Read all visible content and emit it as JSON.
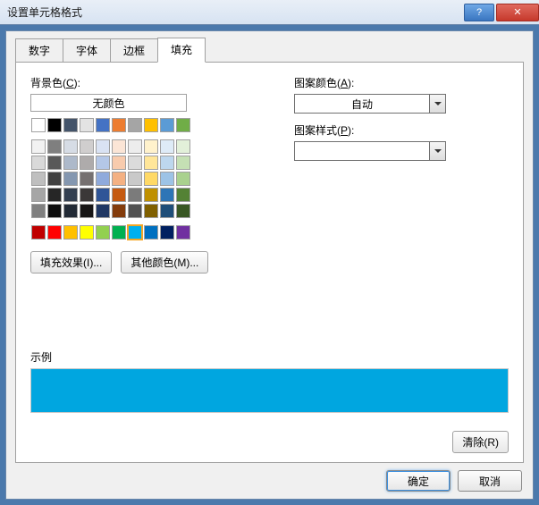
{
  "window": {
    "title": "设置单元格格式"
  },
  "tabs": [
    {
      "label": "数字",
      "active": false
    },
    {
      "label": "字体",
      "active": false
    },
    {
      "label": "边框",
      "active": false
    },
    {
      "label": "填充",
      "active": true
    }
  ],
  "fill": {
    "bgcolor_label_pre": "背景色(",
    "bgcolor_key": "C",
    "bgcolor_label_post": "):",
    "no_color_label": "无颜色",
    "effects_label": "填充效果(I)...",
    "more_colors_label": "其他颜色(M)...",
    "colors_row1": [
      "#ffffff",
      "#000000",
      "#44546a",
      "#e3e3e3",
      "#4472c4",
      "#ed7d31",
      "#a5a5a5",
      "#ffc000",
      "#5b9bd5",
      "#70ad47"
    ],
    "colors_theme": [
      "#f2f2f2",
      "#7f7f7f",
      "#d6dce5",
      "#d0cece",
      "#d9e2f3",
      "#fbe5d6",
      "#ededed",
      "#fff2cc",
      "#deebf7",
      "#e2f0d9",
      "#d9d9d9",
      "#595959",
      "#adb9ca",
      "#aeabab",
      "#b4c7e7",
      "#f8cbad",
      "#dbdbdb",
      "#ffe699",
      "#bdd7ee",
      "#c5e0b4",
      "#bfbfbf",
      "#404040",
      "#8497b0",
      "#757070",
      "#8faadc",
      "#f4b183",
      "#c9c9c9",
      "#ffd966",
      "#9dc3e6",
      "#a9d18e",
      "#a6a6a6",
      "#262626",
      "#333f50",
      "#3b3838",
      "#2f5597",
      "#c55a11",
      "#7b7b7b",
      "#bf9000",
      "#2e75b6",
      "#548235",
      "#808080",
      "#0d0d0d",
      "#222a35",
      "#171616",
      "#203864",
      "#843c0c",
      "#525252",
      "#806000",
      "#1f4e79",
      "#385723"
    ],
    "colors_standard": [
      "#c00000",
      "#ff0000",
      "#ffc000",
      "#ffff00",
      "#92d050",
      "#00b050",
      "#00b0f0",
      "#0070c0",
      "#002060",
      "#7030a0"
    ],
    "selected_color": "#00b0f0"
  },
  "pattern": {
    "color_label_pre": "图案颜色(",
    "color_key": "A",
    "color_label_post": "):",
    "color_value": "自动",
    "style_label_pre": "图案样式(",
    "style_key": "P",
    "style_label_post": "):",
    "style_value": ""
  },
  "example": {
    "label": "示例",
    "preview_color": "#00a6e0"
  },
  "buttons": {
    "clear": "清除(R)",
    "ok": "确定",
    "cancel": "取消"
  }
}
